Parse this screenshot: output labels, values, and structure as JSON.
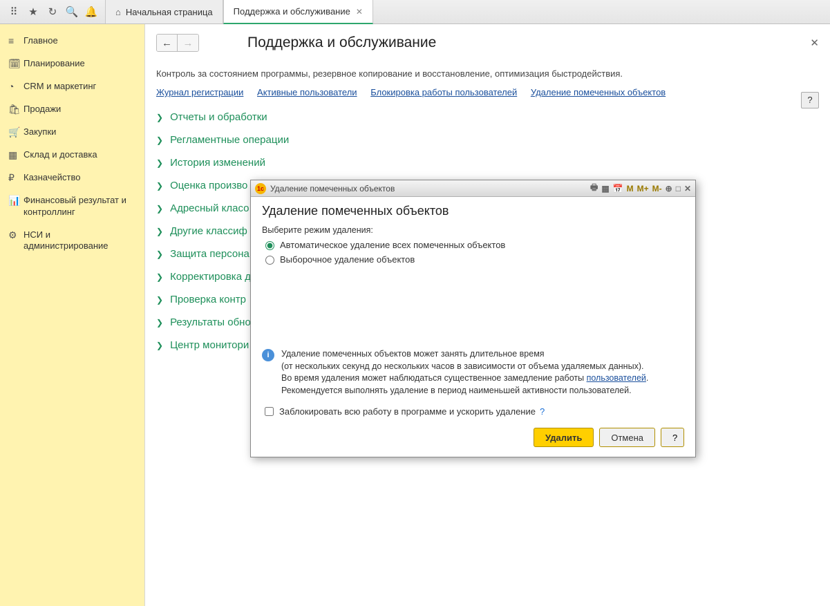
{
  "tabs": {
    "home": "Начальная страница",
    "active": "Поддержка и обслуживание"
  },
  "sidebar": [
    {
      "icon": "≡",
      "label": "Главное"
    },
    {
      "icon": "🗓",
      "label": "Планирование"
    },
    {
      "icon": "◔",
      "label": "CRM и маркетинг"
    },
    {
      "icon": "🛍",
      "label": "Продажи"
    },
    {
      "icon": "🛒",
      "label": "Закупки"
    },
    {
      "icon": "▦",
      "label": "Склад и доставка"
    },
    {
      "icon": "₽",
      "label": "Казначейство"
    },
    {
      "icon": "📊",
      "label": "Финансовый результат и контроллинг"
    },
    {
      "icon": "⚙",
      "label": "НСИ и администрирование"
    }
  ],
  "page": {
    "title": "Поддержка и обслуживание",
    "desc": "Контроль за состоянием программы, резервное копирование и восстановление, оптимизация быстродействия.",
    "help": "?"
  },
  "links": [
    "Журнал регистрации",
    "Активные пользователи",
    "Блокировка работы пользователей",
    "Удаление помеченных объектов"
  ],
  "sections": [
    "Отчеты и обработки",
    "Регламентные операции",
    "История изменений",
    "Оценка произво",
    "Адресный класо",
    "Другие классиф",
    "Защита персона",
    "Корректировка д",
    "Проверка контр",
    "Результаты обно",
    "Центр монитори"
  ],
  "dialog": {
    "winTitle": "Удаление помеченных объектов",
    "tools": {
      "m": "M",
      "mp": "M+",
      "mm": "M-"
    },
    "heading": "Удаление помеченных объектов",
    "modeLabel": "Выберите режим удаления:",
    "opt1": "Автоматическое удаление всех помеченных объектов",
    "opt2": "Выборочное удаление объектов",
    "info1": "Удаление помеченных объектов может занять длительное время",
    "info2": "(от нескольких секунд до нескольких часов в зависимости от объема удаляемых данных).",
    "info3a": "Во время удаления может наблюдаться существенное замедление работы ",
    "info3link": "пользователей",
    "info3b": ".",
    "info4": "Рекомендуется выполнять удаление в период наименьшей активности пользователей.",
    "block": "Заблокировать всю работу в программе и ускорить удаление",
    "q": "?",
    "delete": "Удалить",
    "cancel": "Отмена",
    "help": "?"
  }
}
